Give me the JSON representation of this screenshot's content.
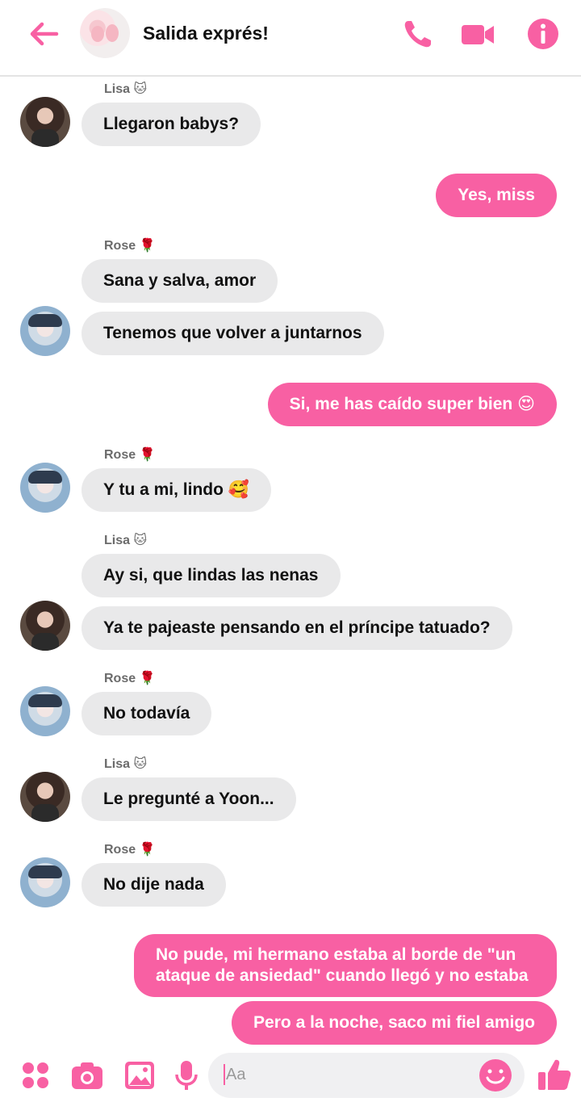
{
  "header": {
    "title": "Salida exprés!",
    "accent": "#f860a3"
  },
  "senders": {
    "lisa": "Lisa 🐱",
    "rose": "Rose 🌹"
  },
  "messages": [
    {
      "text": "Llegaron babys?"
    },
    {
      "text": "Yes, miss"
    },
    {
      "text": "Sana y salva, amor"
    },
    {
      "text": "Tenemos que volver a juntarnos"
    },
    {
      "text": "Si, me has caído super bien 😍"
    },
    {
      "text": "Y tu a mi, lindo 🥰"
    },
    {
      "text": "Ay si, que lindas las nenas"
    },
    {
      "text": "Ya te pajeaste pensando en el príncipe tatuado?"
    },
    {
      "text": "No todavía"
    },
    {
      "text": "Le pregunté a Yoon..."
    },
    {
      "text": "No dije nada"
    },
    {
      "text": "No pude, mi hermano estaba al borde de \"un ataque de ansiedad\" cuando llegó y no estaba"
    },
    {
      "text": "Pero a la noche, saco mi fiel amigo"
    }
  ],
  "composer": {
    "placeholder": "Aa"
  },
  "icons": [
    "back-arrow-icon",
    "phone-icon",
    "video-icon",
    "info-icon",
    "menu-dots-icon",
    "camera-icon",
    "gallery-icon",
    "mic-icon",
    "emoji-icon",
    "like-icon"
  ]
}
